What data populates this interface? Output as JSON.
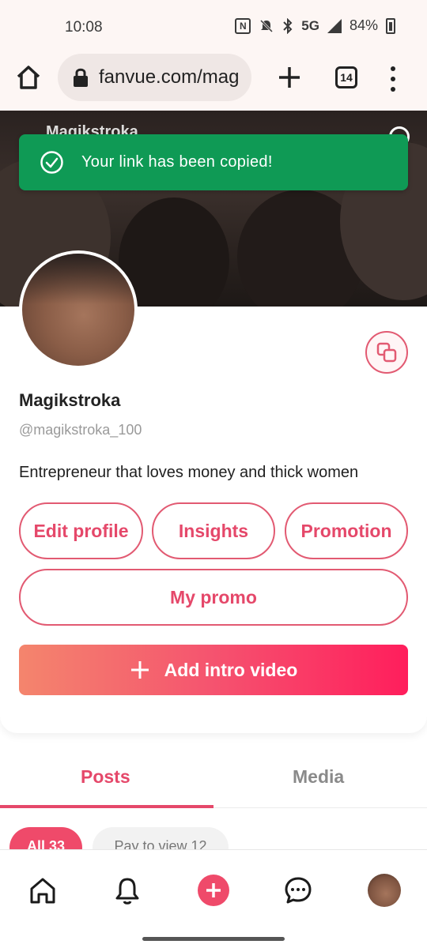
{
  "status_bar": {
    "time": "10:08",
    "network": "5G",
    "battery": "84%",
    "icons": [
      "nfc-icon",
      "mute-icon",
      "bluetooth-icon",
      "signal-icon",
      "battery-icon"
    ]
  },
  "browser": {
    "url": "fanvue.com/mag",
    "tab_count": "14"
  },
  "cover": {
    "name": "Magikstroka"
  },
  "toast": {
    "message": "Your link has been copied!",
    "color": "#0f9a55"
  },
  "profile": {
    "name": "Magikstroka",
    "handle": "@magikstroka_100",
    "bio": "Entrepreneur that loves money and thick women"
  },
  "actions": {
    "edit_profile": "Edit profile",
    "insights": "Insights",
    "promotion": "Promotion",
    "my_promo": "My promo",
    "add_intro_video": "Add intro video"
  },
  "tabs": {
    "posts": "Posts",
    "media": "Media",
    "active": "Posts"
  },
  "filters": {
    "all": "All 33",
    "pay_to_view": "Pay to view 12"
  },
  "colors": {
    "accent": "#e5486a",
    "toast_green": "#0f9a55"
  },
  "bottom_nav": [
    "home-icon",
    "bell-icon",
    "plus-icon",
    "chat-icon",
    "avatar"
  ]
}
